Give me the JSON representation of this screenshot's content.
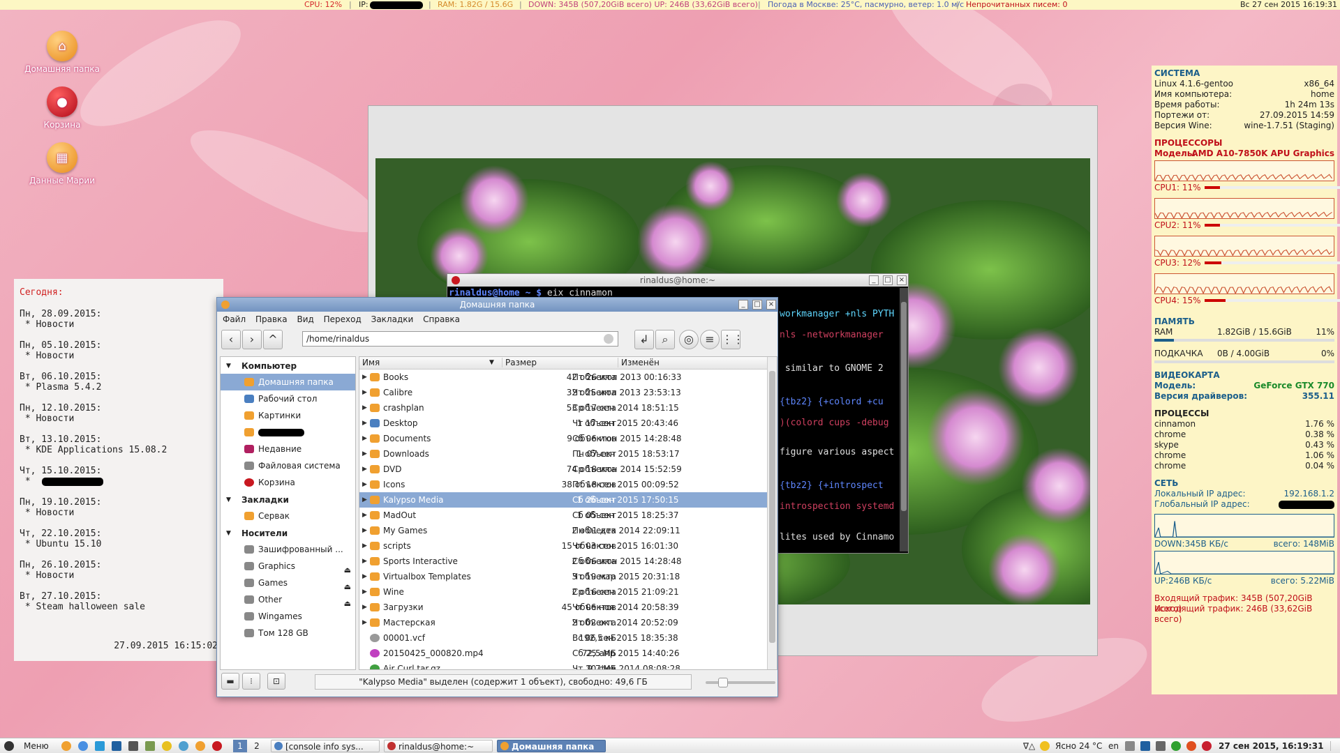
{
  "topbar": {
    "cpu": "CPU: 12%",
    "ip_label": "IP:",
    "ram": "RAM: 1.82G / 15.6G",
    "traffic": "DOWN: 345B (507,20GiB всего) UP: 246B (33,62GiB всего)",
    "weather": "Погода в Москве: 25°C, пасмурно, ветер: 1.0 м/с",
    "mail": "Непрочитанных писем: 0",
    "datetime": "Вс 27 сен 2015 16:19:31",
    "colors": {
      "cpu": "#d4262b",
      "ram": "#d58a2b",
      "traffic": "#c0407b",
      "weather": "#4a5eb5",
      "mail": "#c0101a",
      "datetime": "#222222"
    }
  },
  "desktop_icons": [
    {
      "label": "Домашняя папка",
      "icon": "home-folder-icon",
      "color": "#f0a030"
    },
    {
      "label": "Корзина",
      "icon": "trash-icon",
      "color": "#c81820"
    },
    {
      "label": "Данные Марии",
      "icon": "folder-icon",
      "color": "#f0a030"
    }
  ],
  "calendar": {
    "today_label": "Сегодня:",
    "entries": [
      "Пн, 28.09.2015:\n * Новости",
      "Пн, 05.10.2015:\n * Новости",
      "Вт, 06.10.2015:\n * Plasma 5.4.2",
      "Пн, 12.10.2015:\n * Новости",
      "Вт, 13.10.2015:\n * KDE Applications 15.08.2",
      "Чт, 15.10.2015:\n *",
      "Пн, 19.10.2015:\n * Новости",
      "Чт, 22.10.2015:\n * Ubuntu 15.10",
      "Пн, 26.10.2015:\n * Новости",
      "Вт, 27.10.2015:\n * Steam halloween sale"
    ],
    "timestamp": "27.09.2015 16:15:02"
  },
  "terminal": {
    "title": "rinaldus@home:~",
    "prompt": "rinaldus@home ~ $",
    "command": " eix cinnamon",
    "lines": [
      {
        "text": "workmanager +nls PYTH",
        "color": "#5fd7ff"
      },
      {
        "text": "nls -networkmanager",
        "color": "#d04060"
      },
      {
        "text": " similar to GNOME 2",
        "color": "#e0e0e0"
      },
      {
        "text": "{tbz2} {+colord +cu",
        "color": "#5f87ff"
      },
      {
        "text": ")(colord cups -debug",
        "color": "#d04060"
      },
      {
        "text": "figure various aspect",
        "color": "#e0e0e0"
      },
      {
        "text": "{tbz2} {+introspect",
        "color": "#5f87ff"
      },
      {
        "text": "introspection systemd",
        "color": "#d04060"
      },
      {
        "text": "lites used by Cinnamo",
        "color": "#e0e0e0"
      }
    ]
  },
  "filemanager": {
    "title": "Домашняя папка",
    "menu": [
      "Файл",
      "Правка",
      "Вид",
      "Переход",
      "Закладки",
      "Справка"
    ],
    "path": "/home/rinaldus",
    "sidebar": {
      "computer_header": "Компьютер",
      "computer_items": [
        {
          "label": "Домашняя папка",
          "selected": true,
          "color": "#f0a030"
        },
        {
          "label": "Рабочий стол",
          "color": "#4a7fc0"
        },
        {
          "label": "Картинки",
          "color": "#f0a030"
        },
        {
          "label": "",
          "redacted": true,
          "color": "#f0a030"
        },
        {
          "label": "Недавние",
          "color": "#b02060"
        },
        {
          "label": "Файловая система",
          "color": "#888888"
        },
        {
          "label": "Корзина",
          "color": "#c81820"
        }
      ],
      "bookmarks_header": "Закладки",
      "bookmark_items": [
        {
          "label": "Сервак",
          "color": "#f0a030"
        }
      ],
      "devices_header": "Носители",
      "device_items": [
        {
          "label": "Зашифрованный ...",
          "color": "#888888"
        },
        {
          "label": "Graphics",
          "color": "#888888",
          "eject": true
        },
        {
          "label": "Games",
          "color": "#888888",
          "eject": true
        },
        {
          "label": "Other",
          "color": "#888888",
          "eject": true
        },
        {
          "label": "Wingames",
          "color": "#888888"
        },
        {
          "label": "Том 128 GB",
          "color": "#888888"
        }
      ]
    },
    "columns": {
      "name": "Имя",
      "size": "Размер",
      "modified": "Изменён"
    },
    "files": [
      {
        "name": "Books",
        "size": "42 объекта",
        "date": "Пт 26 июл 2013 00:16:33",
        "color": "#f0a030",
        "dir": true
      },
      {
        "name": "Calibre",
        "size": "32 объекта",
        "date": "Чт 25 июл 2013 23:53:13",
        "color": "#f0a030",
        "dir": true
      },
      {
        "name": "crashplan",
        "size": "53 объекта",
        "date": "Ср 17 сен 2014 18:51:15",
        "color": "#f0a030",
        "dir": true
      },
      {
        "name": "Desktop",
        "size": "1 объект",
        "date": "Чт 17 сен 2015 20:43:46",
        "color": "#4a7fc0",
        "dir": true
      },
      {
        "name": "Documents",
        "size": "9 объектов",
        "date": "Сб 06 июн 2015 14:28:48",
        "color": "#f0a030",
        "dir": true
      },
      {
        "name": "Downloads",
        "size": "1 объект",
        "date": "Пн 07 сен 2015 18:53:17",
        "color": "#f0a030",
        "dir": true
      },
      {
        "name": "DVD",
        "size": "74 объекта",
        "date": "Ср 18 июн 2014 15:52:59",
        "color": "#f0a030",
        "dir": true
      },
      {
        "name": "Icons",
        "size": "38 объектов",
        "date": "Пт 18 сен 2015 00:09:52",
        "color": "#f0a030",
        "dir": true
      },
      {
        "name": "Kalypso Media",
        "size": "1 объект",
        "date": "Сб 26 сен 2015 17:50:15",
        "color": "#f0a030",
        "dir": true,
        "selected": true
      },
      {
        "name": "MadOut",
        "size": "1 объект",
        "date": "Сб 05 сен 2015 18:25:37",
        "color": "#f0a030",
        "dir": true
      },
      {
        "name": "My Games",
        "size": "2 объекта",
        "date": "Пн 01 дек 2014 22:09:11",
        "color": "#f0a030",
        "dir": true
      },
      {
        "name": "scripts",
        "size": "15 объектов",
        "date": "Чт 03 сен 2015 16:01:30",
        "color": "#f0a030",
        "dir": true
      },
      {
        "name": "Sports Interactive",
        "size": "2 объекта",
        "date": "Сб 06 июн 2015 14:28:48",
        "color": "#f0a030",
        "dir": true
      },
      {
        "name": "Virtualbox Templates",
        "size": "3 объекта",
        "date": "Чт 19 мар 2015 20:31:18",
        "color": "#f0a030",
        "dir": true
      },
      {
        "name": "Wine",
        "size": "2 объекта",
        "date": "Ср 16 сен 2015 21:09:21",
        "color": "#f0a030",
        "dir": true
      },
      {
        "name": "Загрузки",
        "size": "45 объектов",
        "date": "Чт 06 ноя 2014 20:58:39",
        "color": "#f0a030",
        "dir": true
      },
      {
        "name": "Мастерская",
        "size": "2 объекта",
        "date": "Чт 02 окт 2014 20:52:09",
        "color": "#f0a030",
        "dir": true
      },
      {
        "name": "00001.vcf",
        "size": "192,5 кБ",
        "date": "Вс 06 сен 2015 18:35:38",
        "color": "#999999",
        "dir": false
      },
      {
        "name": "20150425_000820.mp4",
        "size": "72,5 МБ",
        "date": "Сб 25 апр 2015 14:40:26",
        "color": "#c040c0",
        "dir": false
      },
      {
        "name": "Air Curl.tar.gz",
        "size": "9,7 МБ",
        "date": "Чт 20 фев 2014 08:08:28",
        "color": "#40a040",
        "dir": false
      }
    ],
    "status": "\"Kalypso Media\" выделен (содержит 1 объект), свободно: 49,6 ГБ"
  },
  "conky": {
    "system_header": "СИСТЕМА",
    "system": [
      [
        "Linux 4.1.6-gentoo",
        "x86_64"
      ],
      [
        "Имя компьютера:",
        "home"
      ],
      [
        "Время работы:",
        "1h 24m 13s"
      ],
      [
        "Портежи от:",
        "27.09.2015 14:59"
      ],
      [
        "Версия Wine:",
        "wine-1.7.51 (Staging)"
      ]
    ],
    "cpu_header": "ПРОЦЕССОРЫ",
    "cpu_model_label": "Модель:",
    "cpu_model": "AMD A10-7850K APU Graphics",
    "cpus": [
      {
        "label": "CPU1: 11%",
        "value": 0.11
      },
      {
        "label": "CPU2: 11%",
        "value": 0.11
      },
      {
        "label": "CPU3: 12%",
        "value": 0.12
      },
      {
        "label": "CPU4: 15%",
        "value": 0.15
      }
    ],
    "memory_header": "ПАМЯТЬ",
    "ram_label": "RAM",
    "ram_value": "1.82GiB / 15.6GiB",
    "ram_pct": "11%",
    "ram_fraction": 0.11,
    "swap_label": "ПОДКАЧКА",
    "swap_value": "0B  / 4.00GiB",
    "swap_pct": "0%",
    "gpu_header": "ВИДЕОКАРТА",
    "gpu_model_label": "Модель:",
    "gpu_model": "GeForce GTX 770",
    "gpu_driver_label": "Версия драйверов:",
    "gpu_driver": "355.11",
    "proc_header": "ПРОЦЕССЫ",
    "processes": [
      [
        "cinnamon",
        "1.76 %"
      ],
      [
        "chrome",
        "0.38 %"
      ],
      [
        "skype",
        "0.43 %"
      ],
      [
        "chrome",
        "1.06 %"
      ],
      [
        "chrome",
        "0.04 %"
      ]
    ],
    "net_header": "СЕТЬ",
    "local_ip_label": "Локальный IP адрес:",
    "local_ip": "192.168.1.2",
    "global_ip_label": "Глобальный IP адрес:",
    "down_label": "DOWN:345B  КБ/с",
    "down_total": "всего: 148MiB",
    "up_label": "UP:246B  КБ/с",
    "up_total": "всего: 5.22MiB",
    "in_traffic": "Входящий трафик: 345B  (507,20GiB всего)",
    "out_traffic": "Исходящий трафик: 246B  (33,62GiB всего)"
  },
  "taskbar": {
    "menu_label": "Меню",
    "workspaces": [
      "1",
      "2"
    ],
    "tasks": [
      {
        "label": "[console info sys...",
        "active": false,
        "color": "#4a7fc0"
      },
      {
        "label": "rinaldus@home:~",
        "active": false,
        "color": "#c03030"
      },
      {
        "label": "Домашняя папка",
        "active": true,
        "color": "#f0a030"
      }
    ],
    "keyboard": "∇△",
    "weather": "Ясно 24 °C",
    "lang": "en",
    "clock": "27 сен 2015, 16:19:31",
    "launchers": [
      "firefox-icon",
      "chrome-icon",
      "mail-icon",
      "skype-icon",
      "terminal-icon",
      "wine-icon",
      "radiation-icon",
      "disk-icon",
      "music-icon",
      "folder-icon",
      "red-icon"
    ]
  }
}
